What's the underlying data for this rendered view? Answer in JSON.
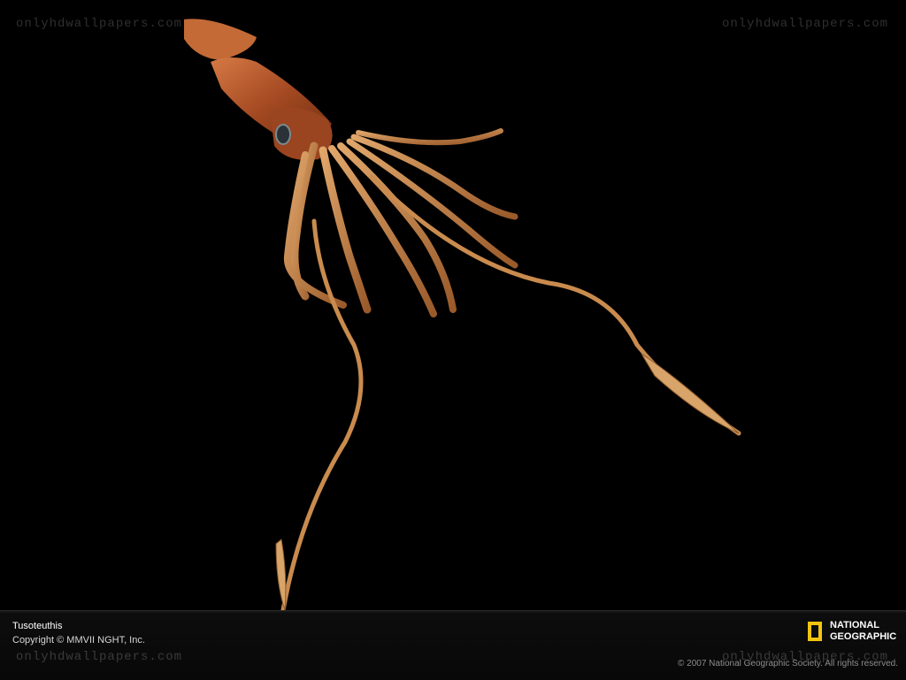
{
  "watermark": {
    "top_left": "onlyhdwallpapers.com",
    "top_right": "onlyhdwallpapers.com",
    "bottom_left": "onlyhdwallpapers.com",
    "bottom_right": "onlyhdwallpapers.com"
  },
  "caption": {
    "title": "Tusoteuthis",
    "copyright": "Copyright © MMVII NGHT, Inc.",
    "rights": "© 2007 National Geographic Society. All rights reserved."
  },
  "logo": {
    "line1": "NATIONAL",
    "line2": "GEOGRAPHIC",
    "frame_color": "#f2c40f"
  },
  "colors": {
    "background": "#000000",
    "squid_body": "#b0532a",
    "tentacle": "#c98b4e"
  }
}
